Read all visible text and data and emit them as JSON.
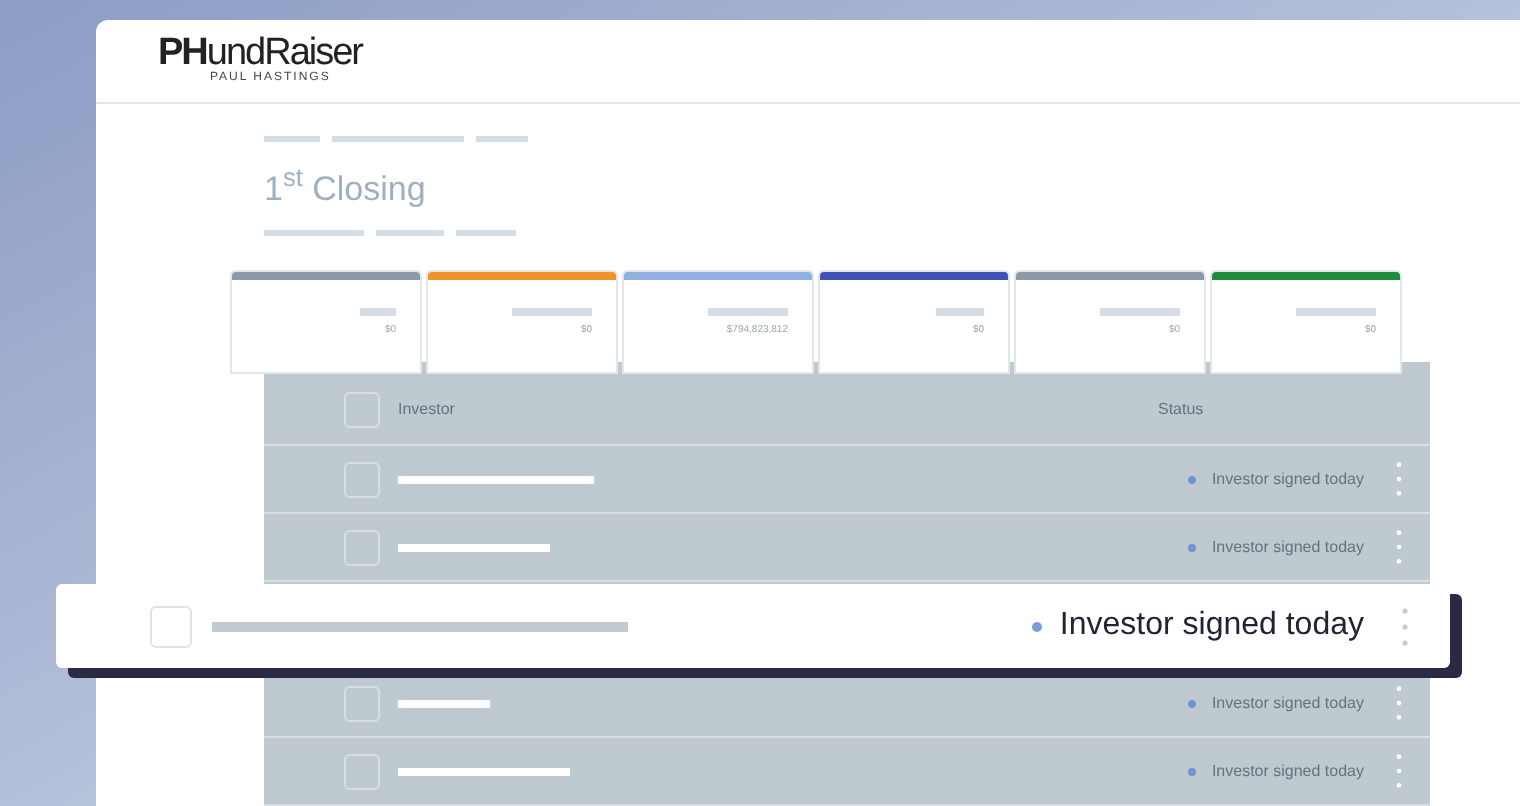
{
  "header": {
    "logo": "**PH**undRaiser",
    "logo_sub": "PAUL HASTINGS"
  },
  "title": "1$^{st}$ Closing",
  "stages": [
    {
      "color": "#8e9aa5",
      "amount": "$0"
    },
    {
      "color": "#f0932b",
      "amount": "$0"
    },
    {
      "color": "#8fb0e0",
      "amount": "$794,823,812"
    },
    {
      "color": "#3f51b5",
      "amount": "$0"
    },
    {
      "color": "#8e9aa5",
      "amount": "$0"
    },
    {
      "color": "#1e8e3e",
      "amount": "$0"
    }
  ],
  "table": {
    "columns": [
      "Investor",
      "Status"
    ],
    "select_all_checked": false,
    "rows": [
      {
        "status": "Investor signed today",
        "highlighted": false,
        "checked": false
      },
      {
        "status": "Investor signed today",
        "highlighted": false,
        "checked": false
      },
      {
        "status": "Investor signed today",
        "highlighted": true,
        "checked": false
      },
      {
        "status": "Investor signed today",
        "highlighted": false,
        "checked": false
      },
      {
        "status": "Investor signed today",
        "highlighted": false,
        "checked": false
      }
    ]
  }
}
